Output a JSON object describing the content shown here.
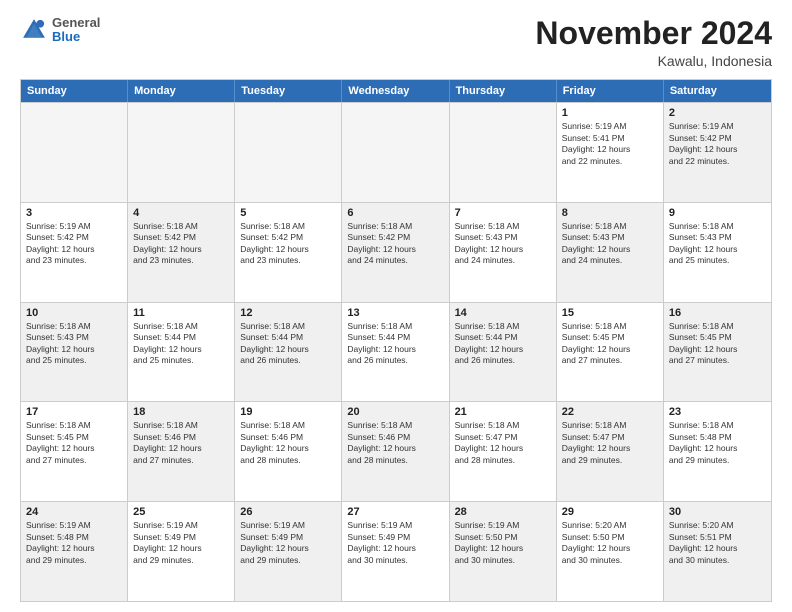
{
  "logo": {
    "general": "General",
    "blue": "Blue"
  },
  "title": "November 2024",
  "location": "Kawalu, Indonesia",
  "header_days": [
    "Sunday",
    "Monday",
    "Tuesday",
    "Wednesday",
    "Thursday",
    "Friday",
    "Saturday"
  ],
  "rows": [
    [
      {
        "day": "",
        "info": "",
        "empty": true
      },
      {
        "day": "",
        "info": "",
        "empty": true
      },
      {
        "day": "",
        "info": "",
        "empty": true
      },
      {
        "day": "",
        "info": "",
        "empty": true
      },
      {
        "day": "",
        "info": "",
        "empty": true
      },
      {
        "day": "1",
        "info": "Sunrise: 5:19 AM\nSunset: 5:41 PM\nDaylight: 12 hours\nand 22 minutes."
      },
      {
        "day": "2",
        "info": "Sunrise: 5:19 AM\nSunset: 5:42 PM\nDaylight: 12 hours\nand 22 minutes.",
        "shaded": true
      }
    ],
    [
      {
        "day": "3",
        "info": "Sunrise: 5:19 AM\nSunset: 5:42 PM\nDaylight: 12 hours\nand 23 minutes."
      },
      {
        "day": "4",
        "info": "Sunrise: 5:18 AM\nSunset: 5:42 PM\nDaylight: 12 hours\nand 23 minutes.",
        "shaded": true
      },
      {
        "day": "5",
        "info": "Sunrise: 5:18 AM\nSunset: 5:42 PM\nDaylight: 12 hours\nand 23 minutes."
      },
      {
        "day": "6",
        "info": "Sunrise: 5:18 AM\nSunset: 5:42 PM\nDaylight: 12 hours\nand 24 minutes.",
        "shaded": true
      },
      {
        "day": "7",
        "info": "Sunrise: 5:18 AM\nSunset: 5:43 PM\nDaylight: 12 hours\nand 24 minutes."
      },
      {
        "day": "8",
        "info": "Sunrise: 5:18 AM\nSunset: 5:43 PM\nDaylight: 12 hours\nand 24 minutes.",
        "shaded": true
      },
      {
        "day": "9",
        "info": "Sunrise: 5:18 AM\nSunset: 5:43 PM\nDaylight: 12 hours\nand 25 minutes."
      }
    ],
    [
      {
        "day": "10",
        "info": "Sunrise: 5:18 AM\nSunset: 5:43 PM\nDaylight: 12 hours\nand 25 minutes.",
        "shaded": true
      },
      {
        "day": "11",
        "info": "Sunrise: 5:18 AM\nSunset: 5:44 PM\nDaylight: 12 hours\nand 25 minutes."
      },
      {
        "day": "12",
        "info": "Sunrise: 5:18 AM\nSunset: 5:44 PM\nDaylight: 12 hours\nand 26 minutes.",
        "shaded": true
      },
      {
        "day": "13",
        "info": "Sunrise: 5:18 AM\nSunset: 5:44 PM\nDaylight: 12 hours\nand 26 minutes."
      },
      {
        "day": "14",
        "info": "Sunrise: 5:18 AM\nSunset: 5:44 PM\nDaylight: 12 hours\nand 26 minutes.",
        "shaded": true
      },
      {
        "day": "15",
        "info": "Sunrise: 5:18 AM\nSunset: 5:45 PM\nDaylight: 12 hours\nand 27 minutes."
      },
      {
        "day": "16",
        "info": "Sunrise: 5:18 AM\nSunset: 5:45 PM\nDaylight: 12 hours\nand 27 minutes.",
        "shaded": true
      }
    ],
    [
      {
        "day": "17",
        "info": "Sunrise: 5:18 AM\nSunset: 5:45 PM\nDaylight: 12 hours\nand 27 minutes."
      },
      {
        "day": "18",
        "info": "Sunrise: 5:18 AM\nSunset: 5:46 PM\nDaylight: 12 hours\nand 27 minutes.",
        "shaded": true
      },
      {
        "day": "19",
        "info": "Sunrise: 5:18 AM\nSunset: 5:46 PM\nDaylight: 12 hours\nand 28 minutes."
      },
      {
        "day": "20",
        "info": "Sunrise: 5:18 AM\nSunset: 5:46 PM\nDaylight: 12 hours\nand 28 minutes.",
        "shaded": true
      },
      {
        "day": "21",
        "info": "Sunrise: 5:18 AM\nSunset: 5:47 PM\nDaylight: 12 hours\nand 28 minutes."
      },
      {
        "day": "22",
        "info": "Sunrise: 5:18 AM\nSunset: 5:47 PM\nDaylight: 12 hours\nand 29 minutes.",
        "shaded": true
      },
      {
        "day": "23",
        "info": "Sunrise: 5:18 AM\nSunset: 5:48 PM\nDaylight: 12 hours\nand 29 minutes."
      }
    ],
    [
      {
        "day": "24",
        "info": "Sunrise: 5:19 AM\nSunset: 5:48 PM\nDaylight: 12 hours\nand 29 minutes.",
        "shaded": true
      },
      {
        "day": "25",
        "info": "Sunrise: 5:19 AM\nSunset: 5:49 PM\nDaylight: 12 hours\nand 29 minutes."
      },
      {
        "day": "26",
        "info": "Sunrise: 5:19 AM\nSunset: 5:49 PM\nDaylight: 12 hours\nand 29 minutes.",
        "shaded": true
      },
      {
        "day": "27",
        "info": "Sunrise: 5:19 AM\nSunset: 5:49 PM\nDaylight: 12 hours\nand 30 minutes."
      },
      {
        "day": "28",
        "info": "Sunrise: 5:19 AM\nSunset: 5:50 PM\nDaylight: 12 hours\nand 30 minutes.",
        "shaded": true
      },
      {
        "day": "29",
        "info": "Sunrise: 5:20 AM\nSunset: 5:50 PM\nDaylight: 12 hours\nand 30 minutes."
      },
      {
        "day": "30",
        "info": "Sunrise: 5:20 AM\nSunset: 5:51 PM\nDaylight: 12 hours\nand 30 minutes.",
        "shaded": true
      }
    ]
  ]
}
